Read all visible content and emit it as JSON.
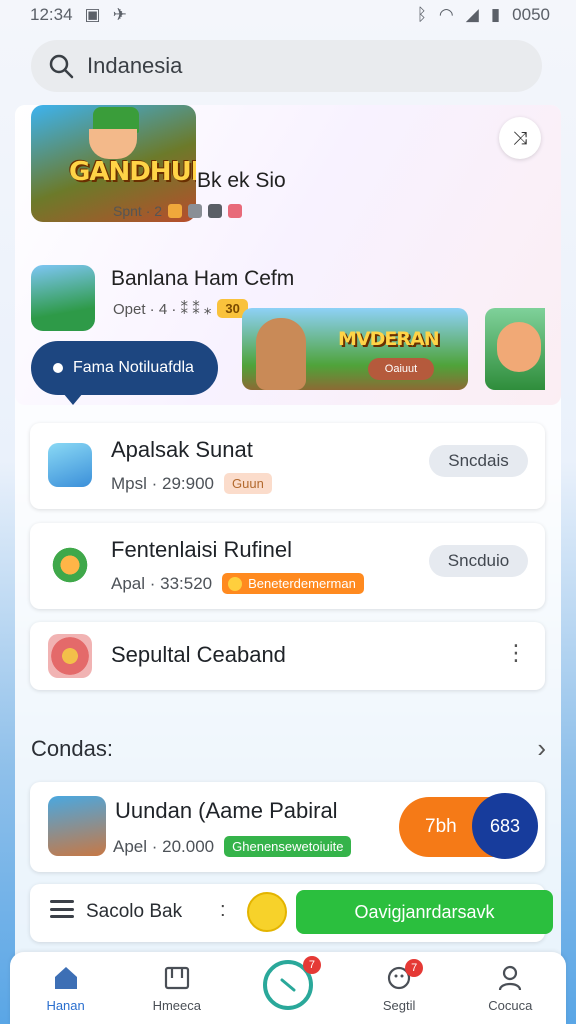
{
  "status_bar": {
    "time": "12:34",
    "battery": "0050"
  },
  "search": {
    "value": "Indanesia"
  },
  "hero": {
    "logo_text": "GANDHUN",
    "title": "Bk ek Sio",
    "subtitle": "Spnt · 2"
  },
  "promo": {
    "title": "Banlana Ham Cefm",
    "subtitle": "Opet · 4 · ⁑ ⁑ ⁎",
    "badge": "30",
    "tooltip": "Fama Notiluafdla",
    "banner_text": "MVDERAN",
    "banner_button": "Oaiuut"
  },
  "cards": [
    {
      "title": "Apalsak  Sunat",
      "meta": "Mpsl · 29:900",
      "badge": "Guun",
      "button": "Sncdais"
    },
    {
      "title": "Fentenlaisi Rufinel",
      "meta": "Apal · 33:520",
      "badge": "Beneterdemerman",
      "button": "Sncduio"
    },
    {
      "title": "Sepultal Ceaband"
    }
  ],
  "section": {
    "title": "Condas:"
  },
  "featured": {
    "title": "Uundan (Aame Pabiral",
    "meta": "Apel · 20.000",
    "badge": "Ghenensewetoiuite",
    "cta": "7bh",
    "count": "683"
  },
  "footer_row": {
    "label": "Sacolo Bak",
    "button": "Oavigjanrdarsavk"
  },
  "nav": [
    {
      "label": "Hanan"
    },
    {
      "label": "Hmeeca"
    },
    {
      "label": "",
      "badge": "7"
    },
    {
      "label": "Segtil",
      "badge": "7"
    },
    {
      "label": "Cocuca"
    }
  ],
  "colors": {
    "accent_blue": "#1d4680",
    "cta_orange": "#f57a17",
    "cta_green": "#2bbf3e",
    "badge_red": "#e53935"
  }
}
